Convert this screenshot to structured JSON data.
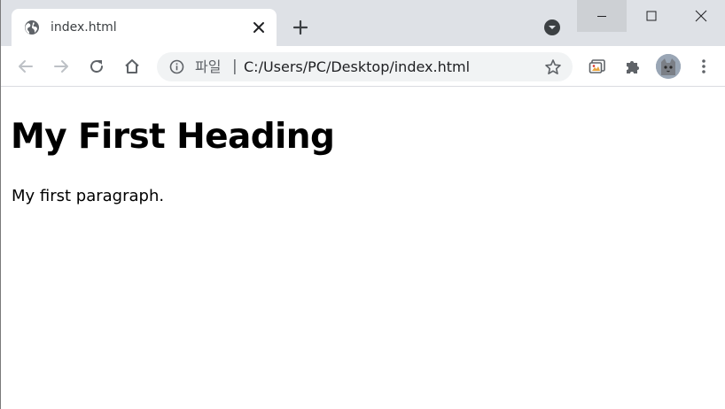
{
  "browser": {
    "tab": {
      "title": "index.html"
    },
    "omnibox": {
      "scheme_label": "파일",
      "separator": "|",
      "url": "C:/Users/PC/Desktop/index.html"
    }
  },
  "page": {
    "heading": "My First Heading",
    "paragraph": "My first paragraph."
  },
  "colors": {
    "tab_strip": "#dee1e6",
    "omnibox_bg": "#f1f3f4",
    "icon": "#5f6368"
  }
}
